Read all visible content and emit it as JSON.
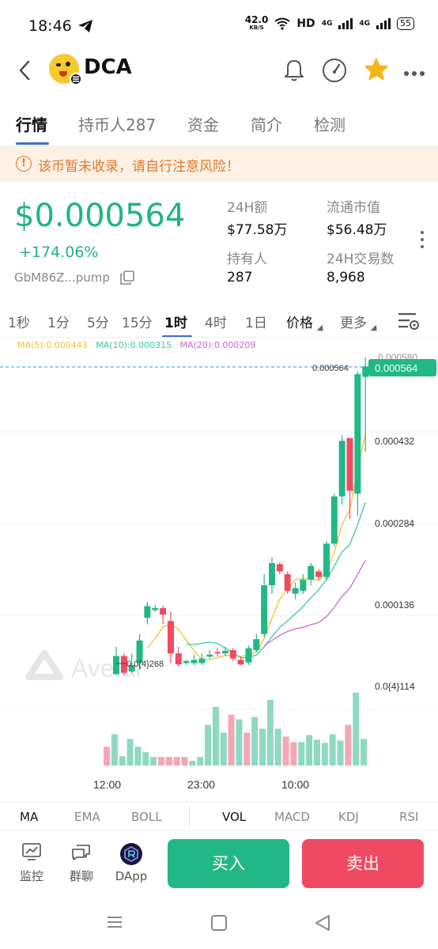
{
  "status_bar": {
    "time": "18:46",
    "net_speed": "42.0",
    "net_unit": "KB/S",
    "hd": "HD",
    "sig1": "4G",
    "sig2": "4G",
    "battery": "55"
  },
  "header": {
    "token_name": "DCA"
  },
  "tabs": [
    {
      "label": "行情"
    },
    {
      "label": "持币人287"
    },
    {
      "label": "资金"
    },
    {
      "label": "简介"
    },
    {
      "label": "检测"
    }
  ],
  "warning": {
    "icon_text": "!",
    "text": "该币暂未收录，请自行注意风险！"
  },
  "price": {
    "value": "$0.000564",
    "change": "+174.06%",
    "address": "GbM86Z...pump"
  },
  "stats": {
    "vol_label": "24H额",
    "vol_value": "$77.58万",
    "mcap_label": "流通市值",
    "mcap_value": "$56.48万",
    "holders_label": "持有人",
    "holders_value": "287",
    "txs_label": "24H交易数",
    "txs_value": "8,968"
  },
  "timeframes": [
    "1秒",
    "1分",
    "5分",
    "15分",
    "1时",
    "4时",
    "1日"
  ],
  "timeframe_price": "价格",
  "timeframe_more": "更多",
  "ma_legend": {
    "ma5": "MA(5):0.000443",
    "ma10": "MA(10):0.000315",
    "ma20": "MA(20):0.000209"
  },
  "colors": {
    "up": "#22b786",
    "down": "#f04a63",
    "ma5": "#f2c230",
    "ma10": "#3bc9a0",
    "ma20": "#c86ad4",
    "accent": "#3a6fd6"
  },
  "chart_data": {
    "type": "candlestick",
    "y_ticks": [
      "0.000432",
      "0.000284",
      "0.000136",
      "0.0{4}114"
    ],
    "top_tick": "0.000580",
    "last_price_label": "0.000564",
    "last_price_badge": "0.000564",
    "low_label": "0.0{4}268",
    "x_ticks": [
      "12:00",
      "23:00",
      "10:00"
    ],
    "watermark": "Ave.ai",
    "candles": [
      {
        "o": 2.8e-05,
        "c": 5.6e-05,
        "h": 7e-05,
        "l": 2.68e-05
      },
      {
        "o": 5.6e-05,
        "c": 3e-05,
        "h": 6e-05,
        "l": 2.68e-05
      },
      {
        "o": 3.2e-05,
        "c": 4.2e-05,
        "h": 6e-05,
        "l": 3e-05
      },
      {
        "o": 4.5e-05,
        "c": 8e-05,
        "h": 9e-05,
        "l": 3.5e-05
      },
      {
        "o": 0.000115,
        "c": 0.000133,
        "h": 0.00014,
        "l": 0.000105
      },
      {
        "o": 0.000127,
        "c": 0.00013,
        "h": 0.000135,
        "l": 0.000124
      },
      {
        "o": 0.00013,
        "c": 0.00012,
        "h": 0.000134,
        "l": 0.000105
      },
      {
        "o": 0.00011,
        "c": 6e-05,
        "h": 0.000125,
        "l": 4.5e-05
      },
      {
        "o": 6e-05,
        "c": 4.3e-05,
        "h": 7e-05,
        "l": 4e-05
      },
      {
        "o": 4.5e-05,
        "c": 4.8e-05,
        "h": 5e-05,
        "l": 4.2e-05
      },
      {
        "o": 4.5e-05,
        "c": 5e-05,
        "h": 5.8e-05,
        "l": 4.2e-05
      },
      {
        "o": 4.5e-05,
        "c": 5.2e-05,
        "h": 6e-05,
        "l": 4.2e-05
      },
      {
        "o": 5.5e-05,
        "c": 5.8e-05,
        "h": 6.5e-05,
        "l": 5.2e-05
      },
      {
        "o": 6.2e-05,
        "c": 6e-05,
        "h": 6.8e-05,
        "l": 5.6e-05
      },
      {
        "o": 6e-05,
        "c": 6.4e-05,
        "h": 7e-05,
        "l": 5.6e-05
      },
      {
        "o": 6.5e-05,
        "c": 5.2e-05,
        "h": 6.8e-05,
        "l": 4.8e-05
      },
      {
        "o": 5e-05,
        "c": 4.3e-05,
        "h": 5.5e-05,
        "l": 4.2e-05
      },
      {
        "o": 4.6e-05,
        "c": 6.8e-05,
        "h": 7.2e-05,
        "l": 4.2e-05
      },
      {
        "o": 6.5e-05,
        "c": 8.2e-05,
        "h": 9e-05,
        "l": 6.2e-05
      },
      {
        "o": 9e-05,
        "c": 0.00017,
        "h": 0.00019,
        "l": 8.5e-05
      },
      {
        "o": 0.00017,
        "c": 0.00021,
        "h": 0.00022,
        "l": 0.000155
      },
      {
        "o": 0.000208,
        "c": 0.000195,
        "h": 0.000212,
        "l": 0.00019
      },
      {
        "o": 0.00019,
        "c": 0.00016,
        "h": 0.000195,
        "l": 0.000155
      },
      {
        "o": 0.000155,
        "c": 0.000165,
        "h": 0.000175,
        "l": 0.000145
      },
      {
        "o": 0.00016,
        "c": 0.00018,
        "h": 0.00019,
        "l": 0.000155
      },
      {
        "o": 0.00018,
        "c": 0.000205,
        "h": 0.00021,
        "l": 0.00017
      },
      {
        "o": 0.000195,
        "c": 0.000185,
        "h": 0.000199,
        "l": 0.00018
      },
      {
        "o": 0.000185,
        "c": 0.000245,
        "h": 0.00025,
        "l": 0.00018
      },
      {
        "o": 0.000245,
        "c": 0.00033,
        "h": 0.000335,
        "l": 0.00024
      },
      {
        "o": 0.00033,
        "c": 0.00043,
        "h": 0.00044,
        "l": 0.000315
      },
      {
        "o": 0.000435,
        "c": 0.00034,
        "h": 0.000435,
        "l": 0.00029
      },
      {
        "o": 0.000335,
        "c": 0.00055,
        "h": 0.000555,
        "l": 0.000295
      },
      {
        "o": 0.000545,
        "c": 0.000564,
        "h": 0.00058,
        "l": 0.00041
      }
    ],
    "volumes": [
      {
        "v": 24,
        "up": false
      },
      {
        "v": 40,
        "up": true
      },
      {
        "v": 12,
        "up": true
      },
      {
        "v": 34,
        "up": true
      },
      {
        "v": 24,
        "up": true
      },
      {
        "v": 17,
        "up": true
      },
      {
        "v": 11,
        "up": true
      },
      {
        "v": 11,
        "up": false
      },
      {
        "v": 11,
        "up": false
      },
      {
        "v": 11,
        "up": false
      },
      {
        "v": 11,
        "up": false
      },
      {
        "v": 6,
        "up": true
      },
      {
        "v": 11,
        "up": true
      },
      {
        "v": 52,
        "up": true
      },
      {
        "v": 75,
        "up": true
      },
      {
        "v": 42,
        "up": true
      },
      {
        "v": 65,
        "up": false
      },
      {
        "v": 59,
        "up": true
      },
      {
        "v": 42,
        "up": false
      },
      {
        "v": 62,
        "up": true
      },
      {
        "v": 47,
        "up": true
      },
      {
        "v": 84,
        "up": true
      },
      {
        "v": 47,
        "up": true
      },
      {
        "v": 37,
        "up": false
      },
      {
        "v": 30,
        "up": false
      },
      {
        "v": 30,
        "up": true
      },
      {
        "v": 39,
        "up": true
      },
      {
        "v": 33,
        "up": true
      },
      {
        "v": 29,
        "up": true
      },
      {
        "v": 40,
        "up": true
      },
      {
        "v": 32,
        "up": true
      },
      {
        "v": 52,
        "up": false
      },
      {
        "v": 93,
        "up": true
      },
      {
        "v": 34,
        "up": true
      }
    ]
  },
  "indicators_left": [
    "MA",
    "EMA",
    "BOLL"
  ],
  "indicators_right": [
    "VOL",
    "MACD",
    "KDJ",
    "RSI"
  ],
  "bottom_bar": {
    "monitor": "监控",
    "group": "群聊",
    "dapp": "DApp",
    "buy": "买入",
    "sell": "卖出"
  }
}
